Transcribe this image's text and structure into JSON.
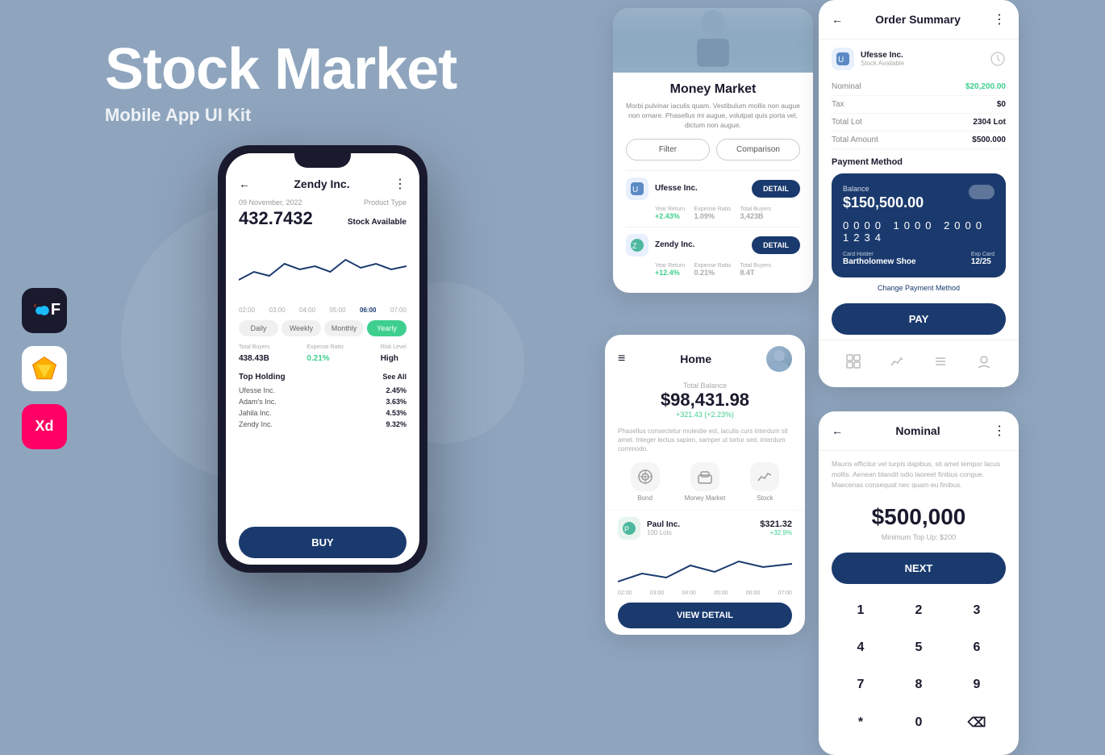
{
  "hero": {
    "title": "Stock Market",
    "subtitle": "Mobile App UI Kit"
  },
  "sidebar_apps": [
    {
      "name": "Figma",
      "emoji": "🎨",
      "class": "app-icon-figma"
    },
    {
      "name": "Sketch",
      "emoji": "💎",
      "class": "app-icon-sketch"
    },
    {
      "name": "XD",
      "emoji": "✕",
      "class": "app-icon-xd"
    }
  ],
  "phone": {
    "header_title": "Zendy Inc.",
    "date": "09 November, 2022",
    "product_type_label": "Product Type",
    "price": "432.7432",
    "product_type": "Stock Available",
    "time_labels": [
      "02:00",
      "03:00",
      "04:00",
      "05:00",
      "06:00",
      "07:00"
    ],
    "periods": [
      "Daily",
      "Weekly",
      "Monthly",
      "Yearly"
    ],
    "active_period": "Yearly",
    "stats": {
      "total_buyers_label": "Total Buyers",
      "total_buyers": "438.43B",
      "expense_ratio_label": "Expense Ratio",
      "expense_ratio": "0.21%",
      "risk_level_label": "Risk Level",
      "risk_level": "High"
    },
    "top_holding_title": "Top Holding",
    "see_all": "See All",
    "holdings": [
      {
        "name": "Ufesse Inc.",
        "value": "2.45%"
      },
      {
        "name": "Adam's Inc.",
        "value": "3.63%"
      },
      {
        "name": "Jahila Inc.",
        "value": "4.53%"
      },
      {
        "name": "Zendy Inc.",
        "value": "9.32%"
      }
    ],
    "buy_btn": "BUY"
  },
  "money_market": {
    "title": "Money Market",
    "description": "Morbi pulvinar iaculis quam. Vestibulum mollis non augue non ornare. Phasellus mi augue, volutpat quis porta vel, dictum non augue.",
    "filter_btn": "Filter",
    "comparison_btn": "Comparison",
    "funds": [
      {
        "name": "Ufesse Inc.",
        "detail_btn": "DETAIL",
        "year_return_label": "Year Return",
        "year_return": "+2.43%",
        "expense_ratio_label": "Expense Ratio",
        "expense_ratio": "1.09%",
        "total_buyers_label": "Total Buyers",
        "total_buyers": "3,423B"
      },
      {
        "name": "Zendy Inc.",
        "detail_btn": "DETAIL",
        "year_return_label": "Year Return",
        "year_return": "+12.4%",
        "expense_ratio_label": "Expense Ratio",
        "expense_ratio": "0.21%",
        "total_buyers_label": "Total Buyers",
        "total_buyers": "8.4T"
      }
    ]
  },
  "home": {
    "title": "Home",
    "balance_label": "Total Balance",
    "balance_amount": "$98,431.98",
    "balance_change": "+321.43 (+2.23%)",
    "description": "Phasellus consectetur molestie est, iaculis curs interdum sit amet. Integer lectus sapien, samper ut tortor sed, interdum commodo.",
    "actions": [
      {
        "label": "Bond",
        "emoji": "🔗"
      },
      {
        "label": "Money Market",
        "emoji": "💹"
      },
      {
        "label": "Stock",
        "emoji": "📊"
      }
    ],
    "fund": {
      "name": "Paul Inc.",
      "lots": "100 Lots",
      "amount": "$321.32",
      "change": "+32.9%"
    },
    "time_labels": [
      "02:00",
      "03:00",
      "04:00",
      "05:00",
      "06:00",
      "07:00"
    ],
    "view_detail_btn": "VIEW DETAIL"
  },
  "order_summary": {
    "title": "Order Summary",
    "company_name": "Ufesse Inc.",
    "company_status": "Stock Available",
    "rows": [
      {
        "label": "Nominal",
        "value": "$20,200.00",
        "green": true
      },
      {
        "label": "Tax",
        "value": "$0",
        "green": false
      },
      {
        "label": "Total Lot",
        "value": "2304 Lot",
        "green": false
      },
      {
        "label": "Total Amount",
        "value": "$500.000",
        "green": false
      }
    ],
    "payment_method_label": "Payment Method",
    "card": {
      "balance_label": "Balance",
      "amount": "$150,500.00",
      "number": "0000  1000  2000  1234",
      "holder_label": "Card Holder",
      "holder_name": "Bartholomew Shoe",
      "exp_label": "Exp Card",
      "exp_date": "12/25"
    },
    "change_payment": "Change Payment Method",
    "pay_btn": "PAY",
    "nav_icons": [
      "grid",
      "chart",
      "list",
      "user"
    ]
  },
  "nominal": {
    "title": "Nominal",
    "description": "Mauris efficitur vel turpis dapibus, sit amet tempor lacus mollis. Aenean blandit odio laoreet finibus congue. Maecenas consequat nec quam eu finibus.",
    "amount": "$500,000",
    "min_top_up": "Minimum Top Up: $200",
    "next_btn": "NEXT",
    "numpad": [
      "1",
      "2",
      "3",
      "4",
      "5",
      "6",
      "7",
      "8",
      "9",
      "*",
      "0",
      "⌫"
    ]
  },
  "colors": {
    "primary": "#1a3a6e",
    "green": "#3ecf8e",
    "bg": "#8fa5be",
    "white": "#ffffff"
  }
}
